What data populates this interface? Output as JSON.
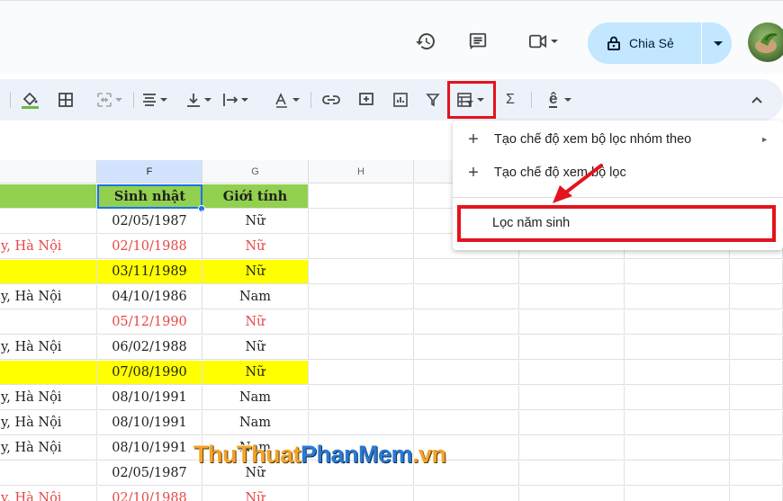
{
  "header": {
    "share_label": "Chia Sẻ",
    "icons": [
      "history-icon",
      "comment-icon",
      "video-call-icon",
      "lock-icon",
      "avatar"
    ]
  },
  "toolbar": {
    "items": [
      "fill-color-icon",
      "borders-icon",
      "merge-cells-icon",
      "horizontal-align-icon",
      "vertical-align-icon",
      "text-wrap-icon",
      "text-rotation-icon",
      "insert-link-icon",
      "insert-comment-icon",
      "insert-chart-icon",
      "filter-icon",
      "filter-views-icon",
      "functions-icon",
      "input-tools-icon",
      "collapse-toolbar-icon"
    ],
    "sigma": "Σ",
    "input_tool": "ê"
  },
  "sheet": {
    "columns": [
      "F",
      "G",
      "H"
    ],
    "headers": {
      "birthday": "Sinh nhật",
      "gender": "Giới tính"
    },
    "rows": [
      {
        "addr": "",
        "date": "02/05/1987",
        "gender": "Nữ",
        "style": "normal"
      },
      {
        "addr": "y, Hà Nội",
        "date": "02/10/1988",
        "gender": "Nữ",
        "style": "red"
      },
      {
        "addr": "",
        "date": "03/11/1989",
        "gender": "Nữ",
        "style": "yellow"
      },
      {
        "addr": "y, Hà Nội",
        "date": "04/10/1986",
        "gender": "Nam",
        "style": "normal"
      },
      {
        "addr": "",
        "date": "05/12/1990",
        "gender": "Nữ",
        "style": "red"
      },
      {
        "addr": "y, Hà Nội",
        "date": "06/02/1988",
        "gender": "Nữ",
        "style": "normal"
      },
      {
        "addr": "",
        "date": "07/08/1990",
        "gender": "Nữ",
        "style": "yellow"
      },
      {
        "addr": "y, Hà Nội",
        "date": "08/10/1991",
        "gender": "Nam",
        "style": "normal"
      },
      {
        "addr": "y, Hà Nội",
        "date": "08/10/1991",
        "gender": "Nam",
        "style": "normal"
      },
      {
        "addr": "y, Hà Nội",
        "date": "08/10/1991",
        "gender": "Nam",
        "style": "normal"
      },
      {
        "addr": "",
        "date": "02/05/1987",
        "gender": "Nữ",
        "style": "normal"
      },
      {
        "addr": "y, Hà Nội",
        "date": "02/10/1988",
        "gender": "Nữ",
        "style": "red"
      }
    ],
    "colors": {
      "header_green": "#92d050",
      "yellow": "#ffff00",
      "red_text": "#e64747"
    }
  },
  "menu": {
    "items": [
      {
        "label": "Tạo chế độ xem bộ lọc nhóm theo",
        "submenu": "►"
      },
      {
        "label": "Tạo chế độ xem bộ lọc"
      },
      {
        "label": "Lọc năm sinh"
      }
    ]
  },
  "watermark": {
    "part1": "ThuThuat",
    "part2": "PhanMem",
    "part3": ".vn"
  },
  "accent": {
    "highlight_red": "#e3141c"
  }
}
